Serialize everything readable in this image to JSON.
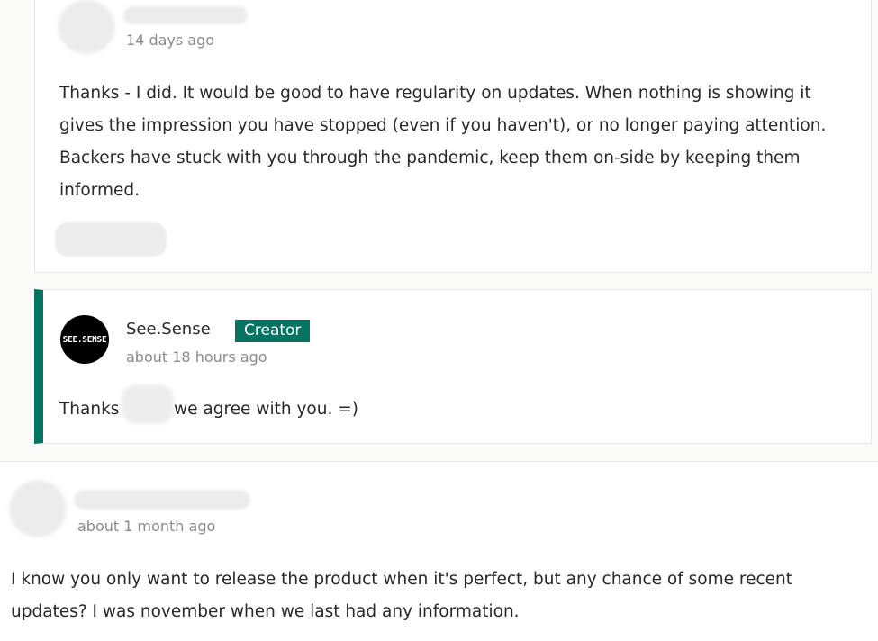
{
  "reply_1": {
    "timestamp": "14 days ago",
    "body": "Thanks - I did. It would be good to have regularity on updates. When nothing is showing it gives the impression you have stopped (even if you haven't), or no longer paying attention. Backers have stuck with you through the pandemic, keep them on-side by keeping them informed."
  },
  "reply_2": {
    "avatar_text": "SEE.SENSE",
    "author": "See.Sense",
    "badge": "Creator",
    "timestamp": "about 18 hours ago",
    "body_before": "Thanks",
    "body_after": "we agree with you. =)"
  },
  "comment_2": {
    "timestamp": "about 1 month ago",
    "body": "I know you only want to release the product when it's perfect, but any chance of some recent updates? I was november when we last had any information."
  },
  "colors": {
    "accent": "#037362",
    "background": "#fafaf8",
    "card": "#ffffff",
    "muted_text": "#8b8b8b"
  }
}
